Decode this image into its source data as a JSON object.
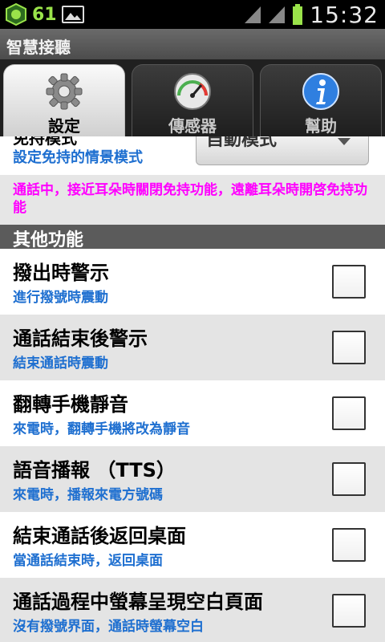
{
  "status_bar": {
    "battery_badge_text": "61",
    "time": "15:32"
  },
  "title_bar": {
    "title": "智慧接聽"
  },
  "tabs": [
    {
      "label": "設定",
      "icon": "gear-icon",
      "active": true
    },
    {
      "label": "傳感器",
      "icon": "gauge-icon",
      "active": false
    },
    {
      "label": "幫助",
      "icon": "info-icon",
      "active": false
    }
  ],
  "partial_setting": {
    "title": "免持模式",
    "subtitle": "設定免持的情景模式",
    "spinner_value": "自動模式"
  },
  "note": "通話中，接近耳朵時關閉免持功能，遠離耳朵時開啓免持功能",
  "section_header": "其他功能",
  "items": [
    {
      "title": "撥出時警示",
      "subtitle": "進行撥號時震動",
      "checked": false
    },
    {
      "title": "通話結束後警示",
      "subtitle": "結束通話時震動",
      "checked": false
    },
    {
      "title": "翻轉手機靜音",
      "subtitle": "來電時，翻轉手機將改為靜音",
      "checked": false
    },
    {
      "title": "語音播報 （TTS）",
      "subtitle": "來電時，播報來電方號碼",
      "checked": false
    },
    {
      "title": "結束通話後返回桌面",
      "subtitle": "當通話結束時，返回桌面",
      "checked": false
    },
    {
      "title": "通話過程中螢幕呈現空白頁面",
      "subtitle": "沒有撥號界面，通話時螢幕空白",
      "checked": false
    }
  ],
  "colors": {
    "accent_blue": "#1e6fd0",
    "note_magenta": "#ff00ff",
    "section_bg": "#5b5b5b"
  }
}
